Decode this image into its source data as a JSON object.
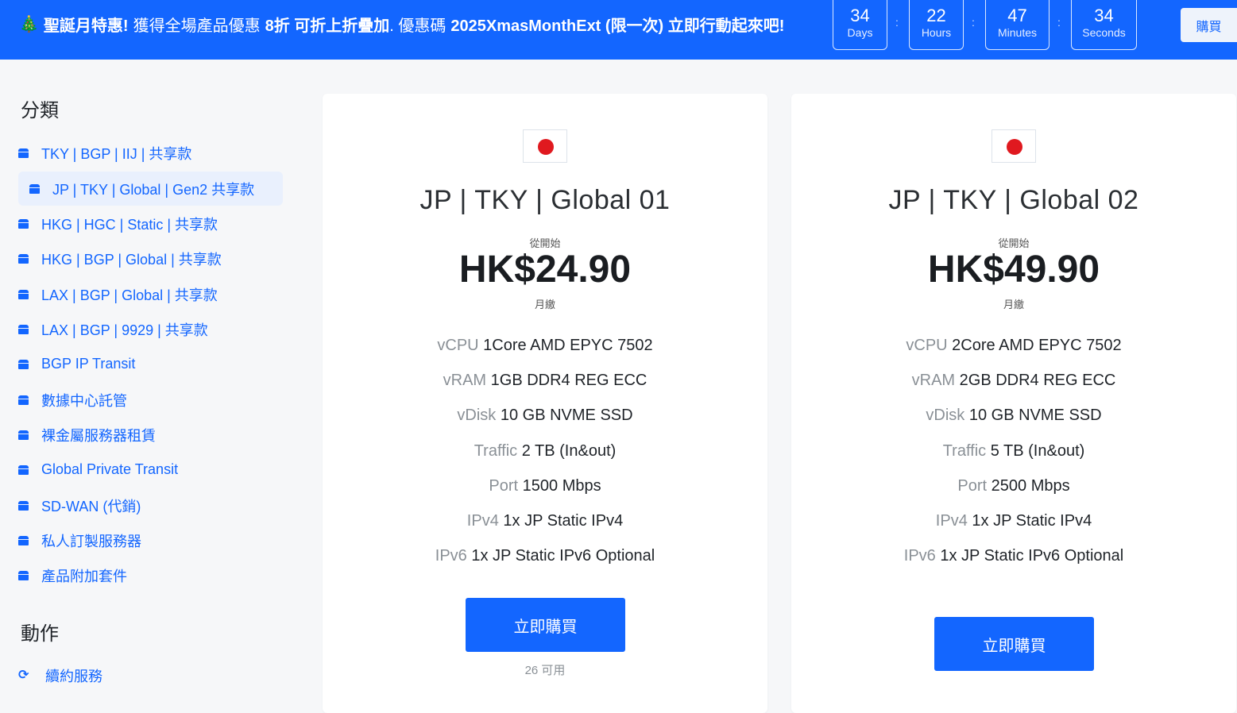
{
  "banner": {
    "tree_icon": "christmas-tree-icon",
    "prefix": "聖誕月特惠!",
    "text1": "獲得全場產品優惠",
    "discount": "8折 可折上折疊加",
    "text2": ". 優惠碼",
    "code": "2025XmasMonthExt (限一次) 立即行動起來吧!",
    "countdown": [
      {
        "value": "34",
        "unit": "Days"
      },
      {
        "value": "22",
        "unit": "Hours"
      },
      {
        "value": "47",
        "unit": "Minutes"
      },
      {
        "value": "34",
        "unit": "Seconds"
      }
    ],
    "separator": ":",
    "buy_label": "購買"
  },
  "sidebar": {
    "categories_heading": "分類",
    "items": [
      {
        "label": "TKY | BGP | IIJ | 共享款",
        "icon": "box-icon"
      },
      {
        "label": "JP | TKY | Global | Gen2 共享款",
        "icon": "box-icon",
        "active": true
      },
      {
        "label": "HKG | HGC | Static | 共享款",
        "icon": "box-icon"
      },
      {
        "label": "HKG | BGP | Global | 共享款",
        "icon": "box-icon"
      },
      {
        "label": "LAX | BGP | Global | 共享款",
        "icon": "box-icon"
      },
      {
        "label": "LAX | BGP | 9929 | 共享款",
        "icon": "box-icon"
      },
      {
        "label": "BGP IP Transit",
        "icon": "box-icon"
      },
      {
        "label": "數據中心託管",
        "icon": "box-icon"
      },
      {
        "label": "裸金屬服務器租賃",
        "icon": "box-icon"
      },
      {
        "label": "Global Private Transit",
        "icon": "box-icon"
      },
      {
        "label": "SD-WAN (代銷)",
        "icon": "box-icon"
      },
      {
        "label": "私人訂製服務器",
        "icon": "box-icon"
      },
      {
        "label": "產品附加套件",
        "icon": "box-icon"
      }
    ],
    "actions_heading": "動作",
    "actions": [
      {
        "label": "續約服務",
        "icon": "sync-icon"
      }
    ]
  },
  "products": [
    {
      "flag": "japan-flag-icon",
      "name": "JP | TKY | Global 01",
      "from_label": "從開始",
      "price": "HK$24.90",
      "cycle": "月繳",
      "specs": [
        {
          "key": "vCPU",
          "value": "1Core AMD EPYC 7502"
        },
        {
          "key": "vRAM",
          "value": "1GB DDR4 REG ECC"
        },
        {
          "key": "vDisk",
          "value": "10 GB NVME SSD"
        },
        {
          "key": "Traffic",
          "value": "2 TB (In&out)"
        },
        {
          "key": "Port",
          "value": "1500 Mbps"
        },
        {
          "key": "IPv4",
          "value": "1x JP Static IPv4"
        },
        {
          "key": "IPv6",
          "value": "1x JP Static IPv6 Optional"
        }
      ],
      "buy_label": "立即購買",
      "availability": "26 可用"
    },
    {
      "flag": "japan-flag-icon",
      "name": "JP | TKY | Global 02",
      "from_label": "從開始",
      "price": "HK$49.90",
      "cycle": "月繳",
      "specs": [
        {
          "key": "vCPU",
          "value": "2Core AMD EPYC 7502"
        },
        {
          "key": "vRAM",
          "value": "2GB DDR4 REG ECC"
        },
        {
          "key": "vDisk",
          "value": "10 GB NVME SSD"
        },
        {
          "key": "Traffic",
          "value": "5 TB (In&out)"
        },
        {
          "key": "Port",
          "value": "2500 Mbps"
        },
        {
          "key": "IPv4",
          "value": "1x JP Static IPv4"
        },
        {
          "key": "IPv6",
          "value": "1x JP Static IPv6 Optional"
        }
      ],
      "buy_label": "立即購買"
    }
  ],
  "colors": {
    "accent": "#1366ff",
    "flag_red": "#e0191f",
    "active_bg": "#e9f0fd"
  }
}
